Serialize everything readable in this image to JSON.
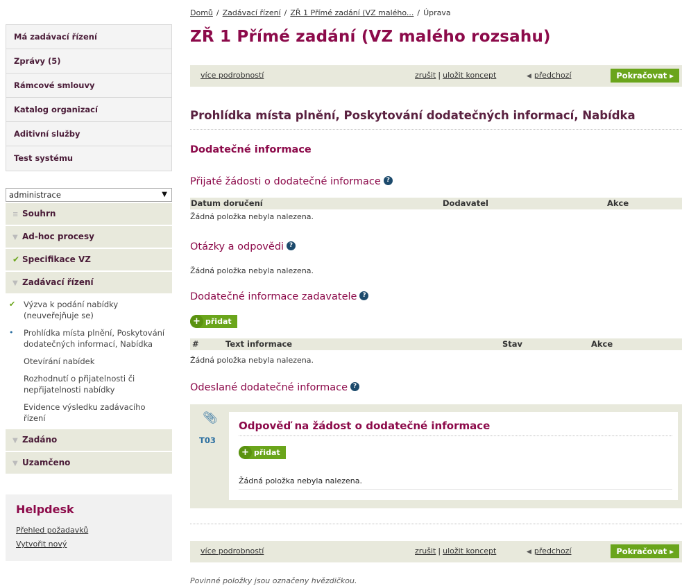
{
  "breadcrumb": {
    "items": [
      "Domů",
      "Zadávací řízení",
      "ZŘ 1 Přímé zadání (VZ malého...",
      "Úprava"
    ]
  },
  "page_title": "ZŘ 1 Přímé zadání (VZ malého rozsahu)",
  "actionbar": {
    "more_label": "více podrobností",
    "cancel_label": "zrušit",
    "save_draft_label": "uložit koncept",
    "prev_label": "předchozí",
    "next_label": "Pokračovat"
  },
  "sidebar": {
    "top_items": [
      "Má zadávací řízení",
      "Zprávy (5)",
      "Rámcové smlouvy",
      "Katalog organizací",
      "Aditivní služby",
      "Test systému"
    ],
    "select_value": "administrace",
    "menu": {
      "souhrn": "Souhrn",
      "adhoc": "Ad-hoc procesy",
      "specifikace": "Specifikace VZ",
      "zadavaci": "Zadávací řízení",
      "sub_items": [
        "Výzva k podání nabídky (neuveřejňuje se)",
        "Prohlídka místa plnění, Poskytování dodatečných informací, Nabídka",
        "Otevírání nabídek",
        "Rozhodnutí o přijatelnosti či nepřijatelnosti nabídky",
        "Evidence výsledku zadávacího řízení"
      ],
      "zadano": "Zadáno",
      "uzamceno": "Uzamčeno"
    },
    "helpdesk": {
      "title": "Helpdesk",
      "links": [
        "Přehled požadavků",
        "Vytvořit nový"
      ]
    }
  },
  "main": {
    "section_title": "Prohlídka místa plnění, Poskytování dodatečných informací, Nabídka",
    "subsection_title": "Dodatečné informace",
    "received": {
      "title": "Přijaté žádosti o dodatečné informace",
      "columns": [
        "Datum doručení",
        "Dodavatel",
        "Akce"
      ],
      "empty": "Žádná položka nebyla nalezena."
    },
    "qa": {
      "title": "Otázky a odpovědi",
      "empty": "Žádná položka nebyla nalezena."
    },
    "contracting": {
      "title": "Dodatečné informace zadavatele",
      "add_label": "přidat",
      "columns": [
        "#",
        "Text informace",
        "Stav",
        "Akce"
      ],
      "empty": "Žádná položka nebyla nalezena."
    },
    "sent": {
      "title": "Odeslané dodatečné informace",
      "box": {
        "code": "T03",
        "title": "Odpověď na žádost o dodatečné informace",
        "add_label": "přidat",
        "empty": "Žádná položka nebyla nalezena."
      }
    },
    "footnote": "Povinné položky jsou označeny hvězdičkou."
  },
  "colors": {
    "accent": "#8c0a4a",
    "panel": "#e8e9dc",
    "success": "#6aa51b",
    "info": "#2a6ea0"
  }
}
